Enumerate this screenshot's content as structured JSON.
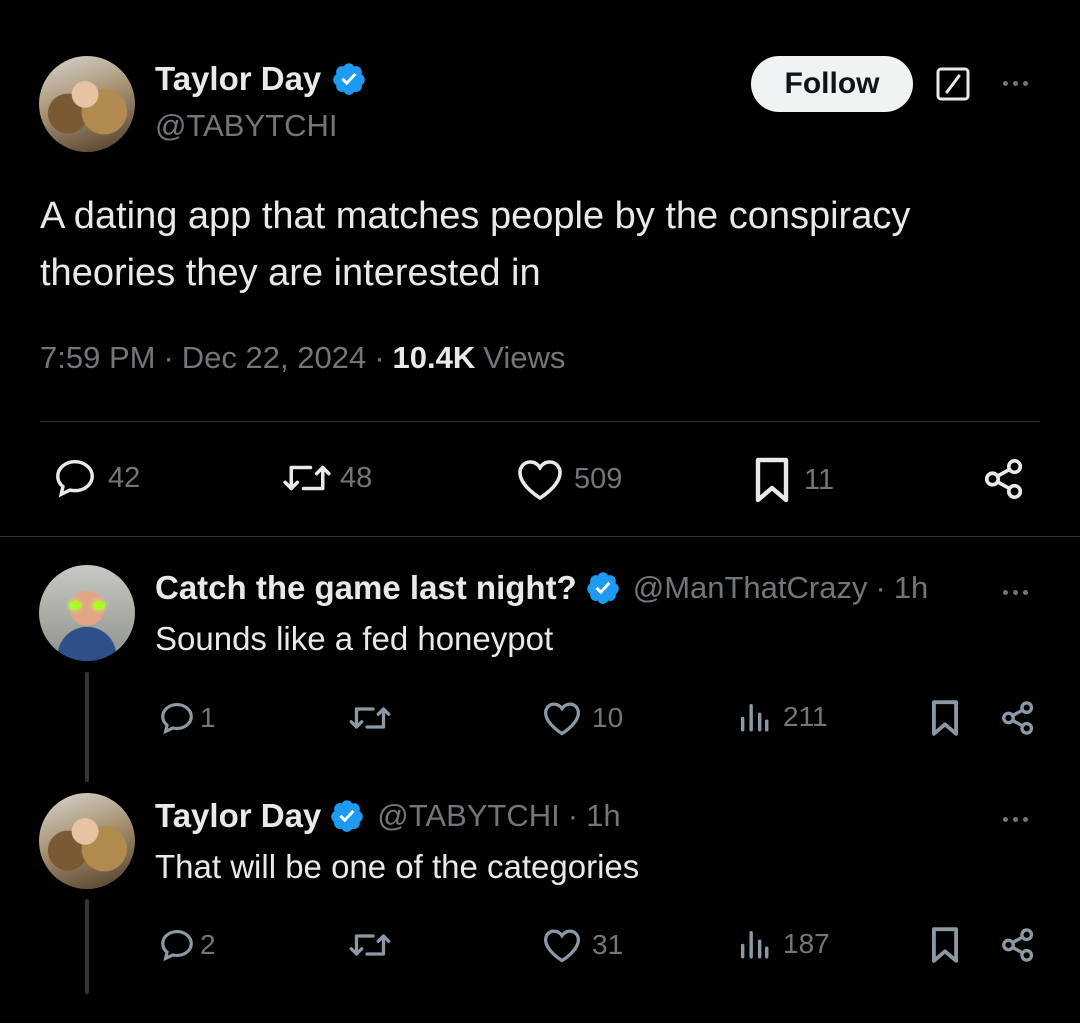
{
  "main_tweet": {
    "author_name": "Taylor Day",
    "author_handle": "@TABYTCHI",
    "follow_label": "Follow",
    "text_line1": "A dating app that matches people by the conspiracy",
    "text_line2": "theories they are interested in",
    "time": "7:59 PM",
    "date": "Dec 22, 2024",
    "views_count": "10.4K",
    "views_label": "Views",
    "replies": "42",
    "reposts": "48",
    "likes": "509",
    "bookmarks": "11"
  },
  "replies": [
    {
      "author_name": "Catch the game last night?",
      "author_handle": "@ManThatCrazy",
      "age": "1h",
      "text": "Sounds like a fed honeypot",
      "replies": "1",
      "likes": "10",
      "views": "211"
    },
    {
      "author_name": "Taylor Day",
      "author_handle": "@TABYTCHI",
      "age": "1h",
      "text": "That will be one of the categories",
      "replies": "2",
      "likes": "31",
      "views": "187"
    }
  ],
  "separator": "·",
  "colors": {
    "verified": "#1d9bf0",
    "muted": "#71767b",
    "text": "#e7e9ea",
    "background": "#000000"
  },
  "icons": [
    "verified-badge-icon",
    "grok-icon",
    "more-icon",
    "reply-icon",
    "repost-icon",
    "like-icon",
    "bookmark-icon",
    "share-icon",
    "views-icon"
  ]
}
